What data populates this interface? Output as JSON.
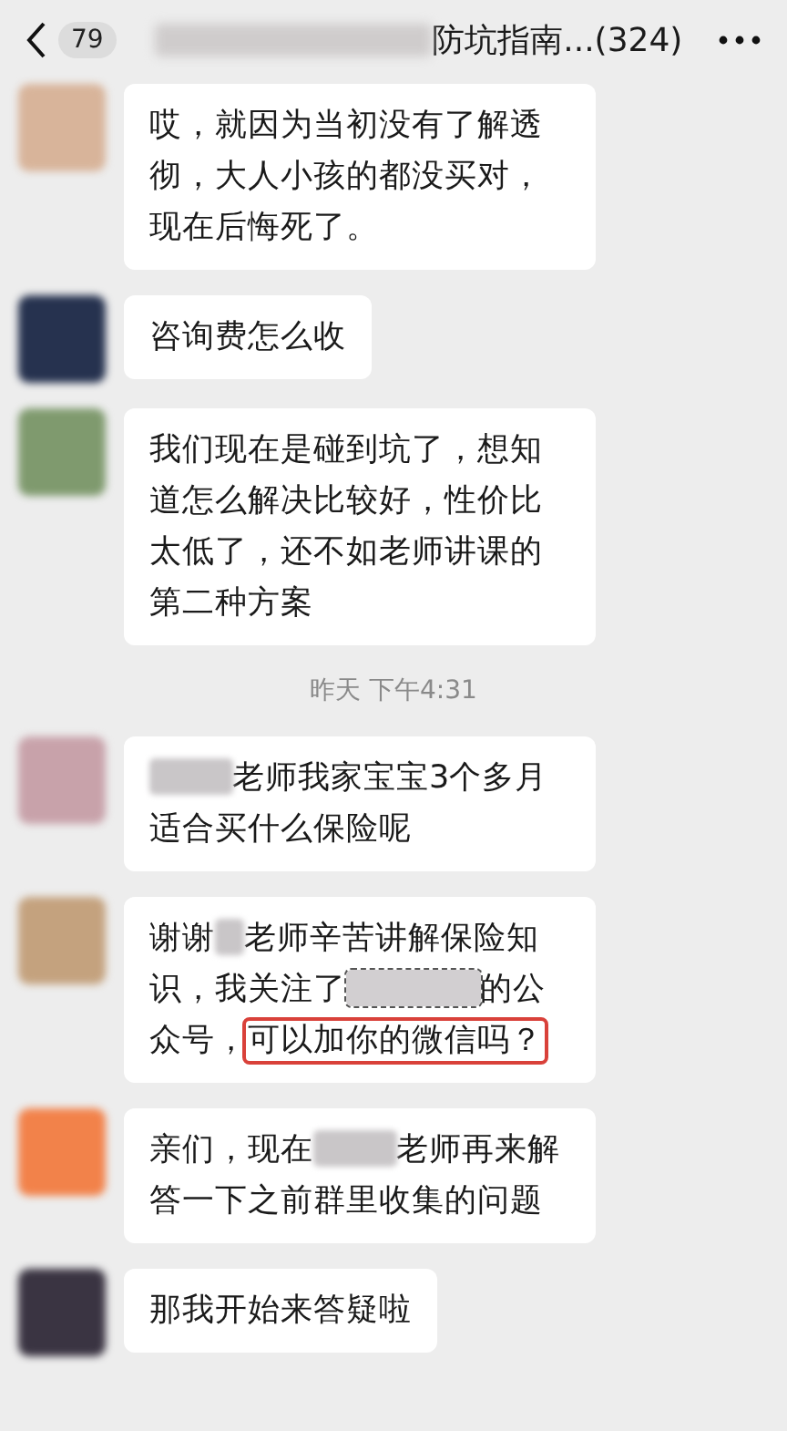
{
  "header": {
    "unread_count": "79",
    "title_parts": [
      {
        "kind": "redacted-wide"
      },
      {
        "kind": "text",
        "text": "防坑指南...(324)"
      }
    ]
  },
  "messages": [
    {
      "kind": "message",
      "avatar": {
        "color": "#d8b49a"
      },
      "parts": [
        {
          "kind": "text",
          "text": "哎，就因为当初没有了解透彻，大人小孩的都没买对，现在后悔死了。"
        }
      ]
    },
    {
      "kind": "message",
      "avatar": {
        "color": "#26324f"
      },
      "parts": [
        {
          "kind": "text",
          "text": "咨询费怎么收"
        }
      ]
    },
    {
      "kind": "message",
      "avatar": {
        "color": "#7f9a6e"
      },
      "parts": [
        {
          "kind": "text",
          "text": "我们现在是碰到坑了，想知道怎么解决比较好，性价比太低了，还不如老师讲课的第二种方案"
        }
      ]
    },
    {
      "kind": "time",
      "text": "昨天 下午4:31"
    },
    {
      "kind": "message",
      "avatar": {
        "color": "#c8a2aa"
      },
      "parts": [
        {
          "kind": "redacted"
        },
        {
          "kind": "text",
          "text": "老师我家宝宝3个多月适合买什么保险呢"
        }
      ]
    },
    {
      "kind": "message",
      "avatar": {
        "color": "#c4a27e"
      },
      "parts": [
        {
          "kind": "text",
          "text": "谢谢"
        },
        {
          "kind": "redacted-narrow"
        },
        {
          "kind": "text",
          "text": "老师辛苦讲解保险知识，我关注了"
        },
        {
          "kind": "redacted-wide"
        },
        {
          "kind": "text",
          "text": "的公众号，"
        },
        {
          "kind": "highlighted",
          "text": "可以加你的微信吗？"
        }
      ]
    },
    {
      "kind": "message",
      "avatar": {
        "color": "#f2824a"
      },
      "parts": [
        {
          "kind": "text",
          "text": "亲们，现在"
        },
        {
          "kind": "redacted"
        },
        {
          "kind": "text",
          "text": "老师再来解答一下之前群里收集的问题"
        }
      ]
    },
    {
      "kind": "message",
      "avatar": {
        "color": "#3a3442"
      },
      "parts": [
        {
          "kind": "text",
          "text": "那我开始来答疑啦"
        }
      ]
    }
  ]
}
